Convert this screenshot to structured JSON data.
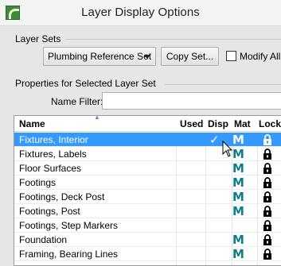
{
  "window": {
    "title": "Layer Display Options"
  },
  "layer_sets": {
    "section_label": "Layer Sets",
    "dropdown_value": "Plumbing Reference Set",
    "copy_button": "Copy Set...",
    "modify_checkbox_label": "Modify All L",
    "modify_checked": false
  },
  "properties": {
    "section_label": "Properties for Selected Layer Set",
    "name_filter_label": "Name Filter:",
    "name_filter_value": ""
  },
  "table": {
    "columns": [
      "Name",
      "Used",
      "Disp",
      "Mat",
      "Lock"
    ],
    "rows": [
      {
        "name": "Fixtures, Interior",
        "used": false,
        "disp": true,
        "mat": "M",
        "lock": true,
        "selected": true
      },
      {
        "name": "Fixtures, Labels",
        "used": false,
        "disp": false,
        "mat": "M",
        "lock": true,
        "selected": false
      },
      {
        "name": "Floor Surfaces",
        "used": false,
        "disp": false,
        "mat": "M",
        "lock": true,
        "selected": false
      },
      {
        "name": "Footings",
        "used": false,
        "disp": false,
        "mat": "M",
        "lock": true,
        "selected": false
      },
      {
        "name": "Footings, Deck Post",
        "used": false,
        "disp": false,
        "mat": "M",
        "lock": true,
        "selected": false
      },
      {
        "name": "Footings, Post",
        "used": false,
        "disp": false,
        "mat": "M",
        "lock": true,
        "selected": false
      },
      {
        "name": "Footings, Step Markers",
        "used": false,
        "disp": false,
        "mat": "",
        "lock": true,
        "selected": false
      },
      {
        "name": "Foundation",
        "used": false,
        "disp": false,
        "mat": "M",
        "lock": true,
        "selected": false
      },
      {
        "name": "Framing, Bearing Lines",
        "used": false,
        "disp": false,
        "mat": "M",
        "lock": true,
        "selected": false
      }
    ]
  },
  "colors": {
    "selection": "#3399ff",
    "material_m": "#0c7d8c"
  }
}
